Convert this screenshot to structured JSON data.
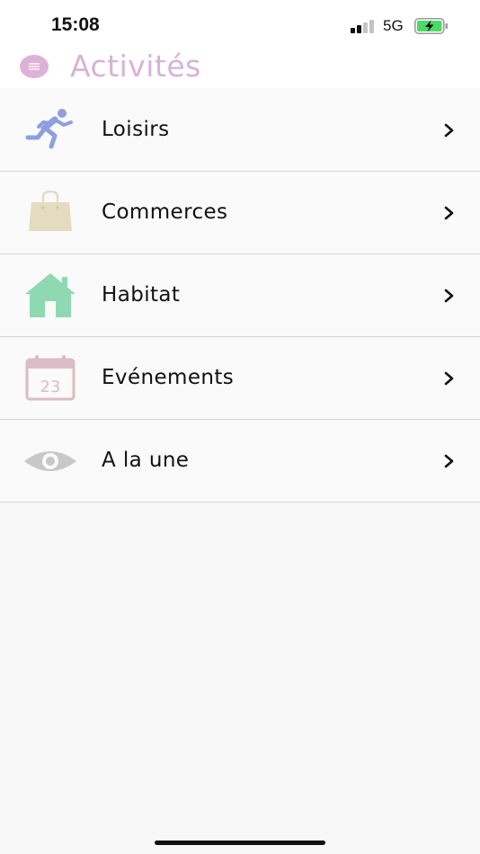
{
  "status_bar": {
    "time": "15:08",
    "network": "5G",
    "battery_charging": true,
    "signal_bars_active": 2,
    "signal_bars_total": 4
  },
  "header": {
    "title": "Activités",
    "accent_color": "#d8b2d6"
  },
  "menu": {
    "items": [
      {
        "label": "Loisirs",
        "icon": "running-person-icon",
        "color": "#8e9fe0"
      },
      {
        "label": "Commerces",
        "icon": "shopping-bag-icon",
        "color": "#e3dcc0"
      },
      {
        "label": "Habitat",
        "icon": "house-icon",
        "color": "#8fd9b2"
      },
      {
        "label": "Evénements",
        "icon": "calendar-icon",
        "color": "#dcbcc4",
        "icon_text": "23"
      },
      {
        "label": "A la une",
        "icon": "eye-icon",
        "color": "#c8c8c8"
      }
    ]
  }
}
